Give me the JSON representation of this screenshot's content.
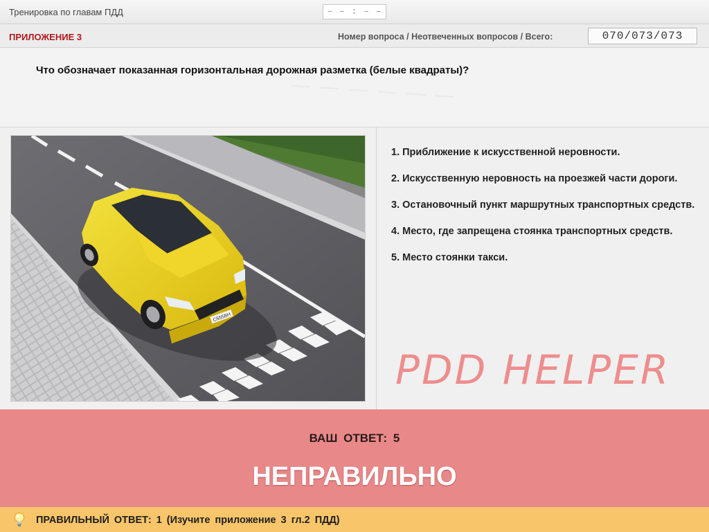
{
  "header": {
    "title": "Тренировка по главам ПДД",
    "timer": "– – : – –"
  },
  "infobar": {
    "appendix": "ПРИЛОЖЕНИЕ 3",
    "counter_label": "Номер вопроса / Неотвеченных вопросов / Всего:",
    "counter_value": "070/073/073"
  },
  "question": {
    "text": "Что обозначает показанная горизонтальная дорожная разметка (белые квадраты)?"
  },
  "answers": [
    "1.  Приближение к искусственной неровности.",
    "2.  Искусственную неровность на проезжей части дороги.",
    "3.  Остановочный пункт маршрутных транспортных средств.",
    "4.  Место, где запрещена стоянка транспортных средств.",
    "5.  Место стоянки такси."
  ],
  "watermark": "PDD HELPER",
  "result": {
    "your_answer": "ВАШ ОТВЕТ:  5",
    "verdict": "НЕПРАВИЛЬНО",
    "color": "#e98889"
  },
  "footer": {
    "correct_answer": "ПРАВИЛЬНЫЙ ОТВЕТ:  1   (Изучите приложение 3 гл.2 ПДД)",
    "color": "#f8c56a",
    "icon": "lightbulb-icon"
  },
  "illustration": {
    "plate": "С555ВН"
  }
}
